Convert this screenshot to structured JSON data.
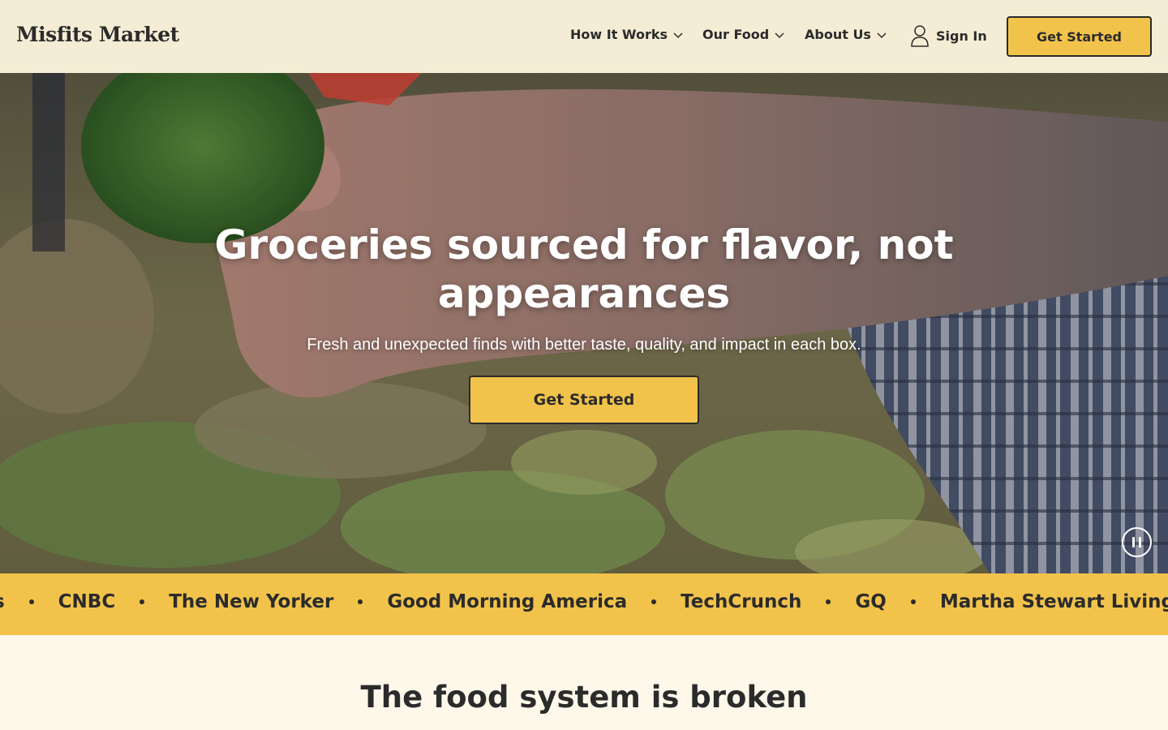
{
  "header": {
    "logo": "Misfits Market",
    "nav": [
      {
        "label": "How It Works"
      },
      {
        "label": "Our Food"
      },
      {
        "label": "About Us"
      }
    ],
    "sign_in": "Sign In",
    "cta": "Get Started"
  },
  "hero": {
    "title": "Groceries sourced for flavor, not appearances",
    "subtitle": "Fresh and unexpected finds with better taste, quality, and impact in each box.",
    "cta": "Get Started"
  },
  "press": {
    "items": [
      "nes",
      "CNBC",
      "The New Yorker",
      "Good Morning America",
      "TechCrunch",
      "GQ",
      "Martha Stewart Living"
    ]
  },
  "section": {
    "title": "The food system is broken"
  },
  "colors": {
    "header_bg": "#f4ecd4",
    "accent_yellow": "#f2c34a",
    "text_dark": "#2b2b2b",
    "page_bg": "#fef8ea"
  },
  "icons": [
    "chevron-down-icon",
    "user-icon",
    "pause-icon"
  ]
}
